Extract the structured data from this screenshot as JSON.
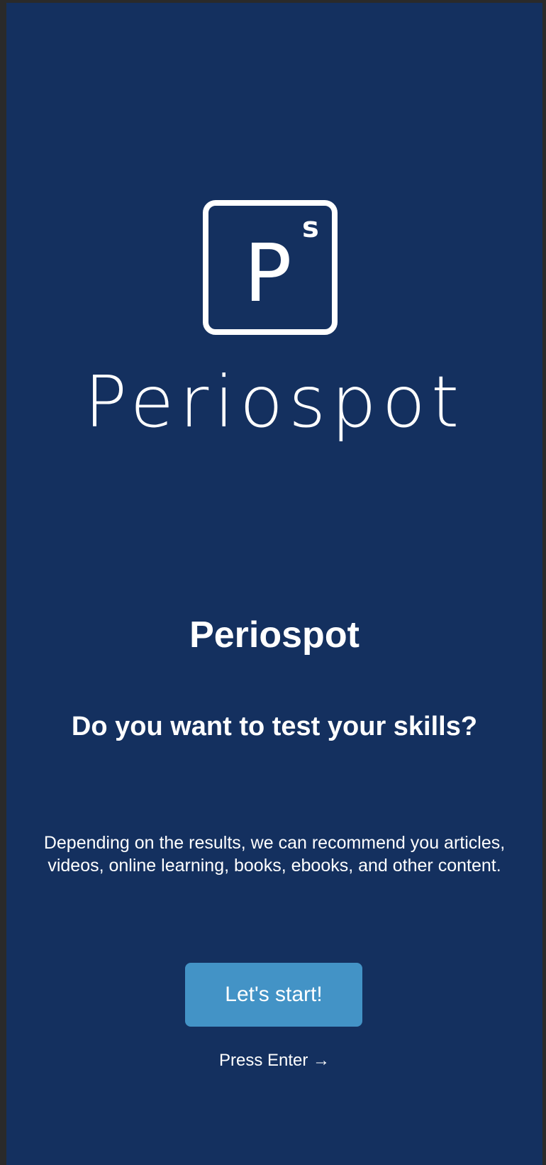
{
  "logo": {
    "letter": "P",
    "superscript": "s",
    "wordmark": "Periospot",
    "icon": "periospot-logo-icon"
  },
  "title": "Periospot",
  "question": "Do you want to test your skills?",
  "description": "Depending on the results, we can recommend you articles, videos, online learning, books, ebooks, and other content.",
  "start_button": {
    "label": "Let's start!"
  },
  "hint": {
    "label": "Press Enter →"
  },
  "colors": {
    "background": "#14305f",
    "button": "#4393c6",
    "text": "#ffffff"
  }
}
